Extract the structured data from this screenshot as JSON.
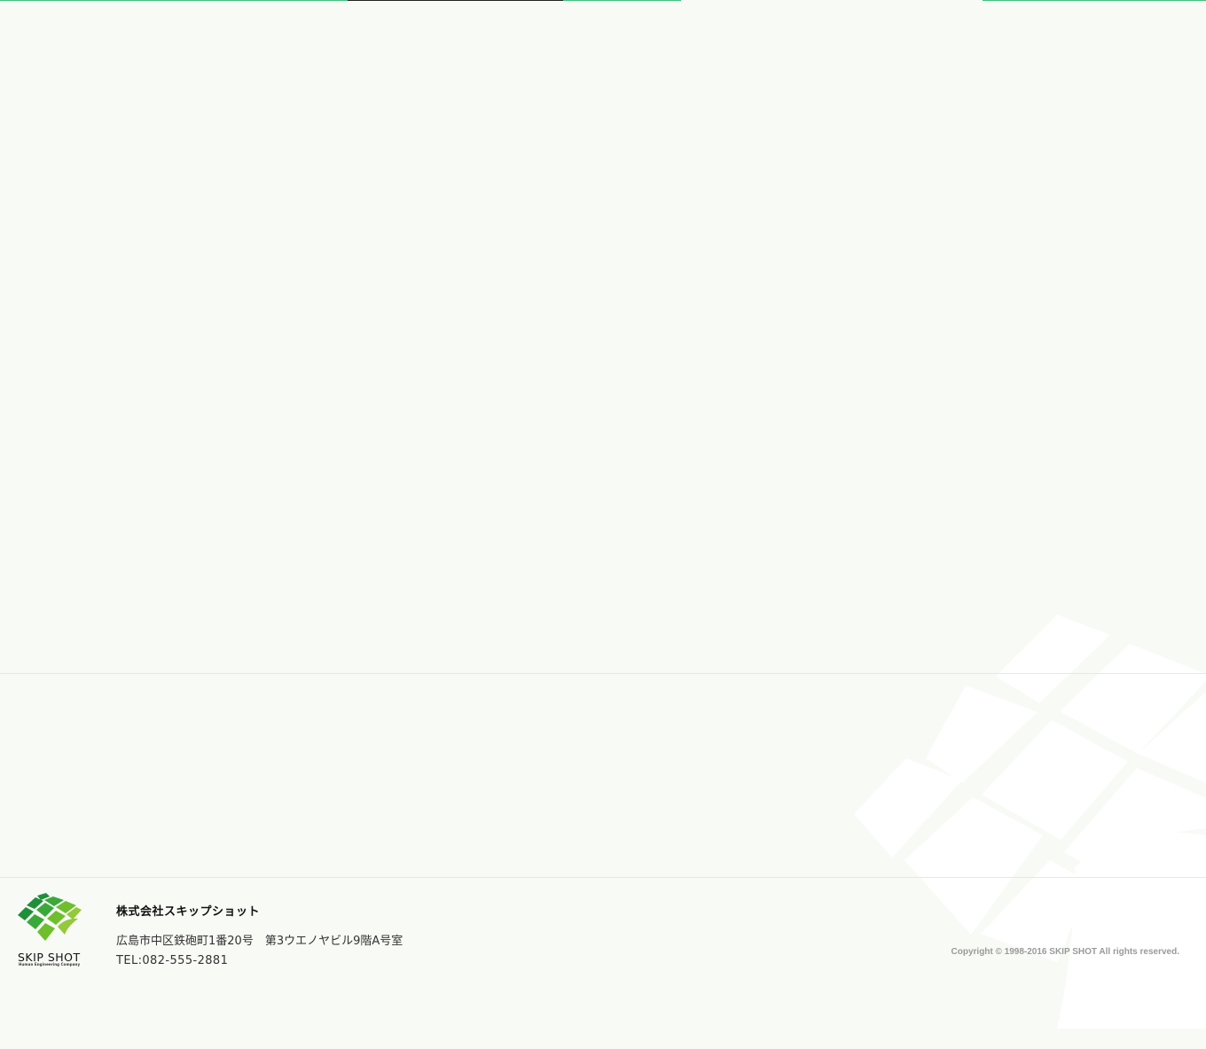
{
  "footer": {
    "logo": {
      "wordmark": "SKIP SHOT",
      "tagline": "Human Engineering Company",
      "colors": [
        "#1f8f3a",
        "#3aa93a",
        "#6fbf2d",
        "#93c93a"
      ]
    },
    "company_name": "株式会社スキップショット",
    "address": "広島市中区鉄砲町1番20号　第3ウエノヤビル9階A号室",
    "tel": "TEL:082-555-2881",
    "copyright": "Copyright © 1998-2016 SKIP SHOT All rights reserved."
  },
  "decor": {
    "page_background": "#f8faf5",
    "top_strip_colors": [
      "#3fbf7f",
      "#222222"
    ],
    "background_mark_color": "#ffffff"
  }
}
